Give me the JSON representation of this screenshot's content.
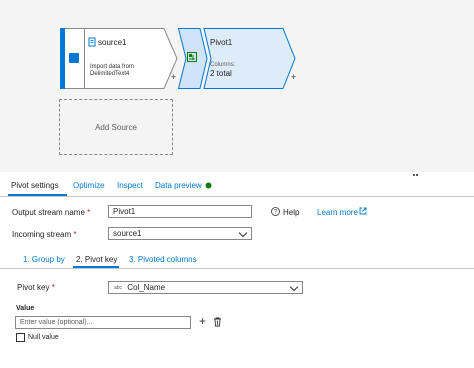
{
  "canvas": {
    "source_node": {
      "title": "source1",
      "subtitle_line1": "Import data from",
      "subtitle_line2": "DelimitedText4"
    },
    "pivot_node": {
      "title": "Pivot1",
      "columns_label": "Columns:",
      "columns_value": "2 total"
    },
    "plus_label": "+",
    "add_source_label": "Add Source"
  },
  "tabs": [
    {
      "label": "Pivot settings",
      "active": true
    },
    {
      "label": "Optimize"
    },
    {
      "label": "Inspect"
    },
    {
      "label": "Data preview"
    }
  ],
  "data_preview_status_color": "#107c10",
  "accent_color": "#0078d4",
  "form": {
    "output_stream_label": "Output stream name",
    "output_stream_value": "Pivot1",
    "incoming_stream_label": "Incoming stream",
    "incoming_stream_value": "source1",
    "help_icon_glyph": "?",
    "help_label": "Help",
    "learn_more_label": "Learn more",
    "required_mark": "*"
  },
  "subtabs": [
    {
      "label": "1. Group by"
    },
    {
      "label": "2. Pivot key",
      "active": true
    },
    {
      "label": "3. Pivoted columns"
    }
  ],
  "pivot_key": {
    "label": "Pivot key",
    "type_badge": "abc",
    "value": "Col_Name"
  },
  "value_section": {
    "label": "Value",
    "placeholder": "Enter value (optional)...",
    "add_glyph": "+",
    "null_value_label": "Null value"
  }
}
